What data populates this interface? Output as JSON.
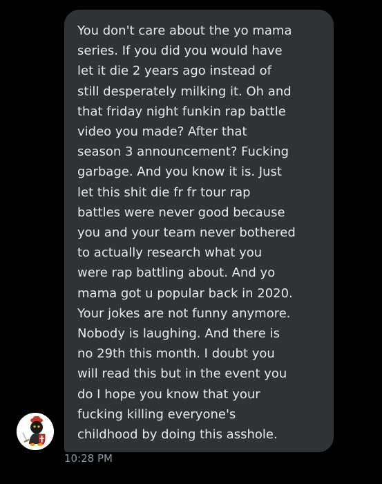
{
  "conversation": {
    "message": {
      "text": "You don't care about the yo mama\nseries. If you did you would have\nlet it die 2 years ago instead of\nstill desperately milking it. Oh and\nthat friday night funkin rap battle\nvideo you made? After that\nseason 3 announcement? Fucking\ngarbage. And you know it is. Just\nlet this shit die fr fr tour rap\nbattles were never good because\nyou and your team never bothered\nto actually research what you\nwere rap battling about. And yo\nmama got u popular back in 2020.\nYour jokes are not funny anymore.\nNobody is laughing. And there is\nno 29th this month. I doubt you\nwill read this but in the event you\ndo I hope you know that your\nfucking killing everyone's\nchildhood by doing this asshole.",
      "timestamp": "10:28 PM"
    },
    "avatar": {
      "icon": "knight-avatar-icon"
    }
  },
  "colors": {
    "background": "#000000",
    "bubble": "#2f3336",
    "text": "#e7e9ea",
    "timestamp": "#8b98a5"
  }
}
